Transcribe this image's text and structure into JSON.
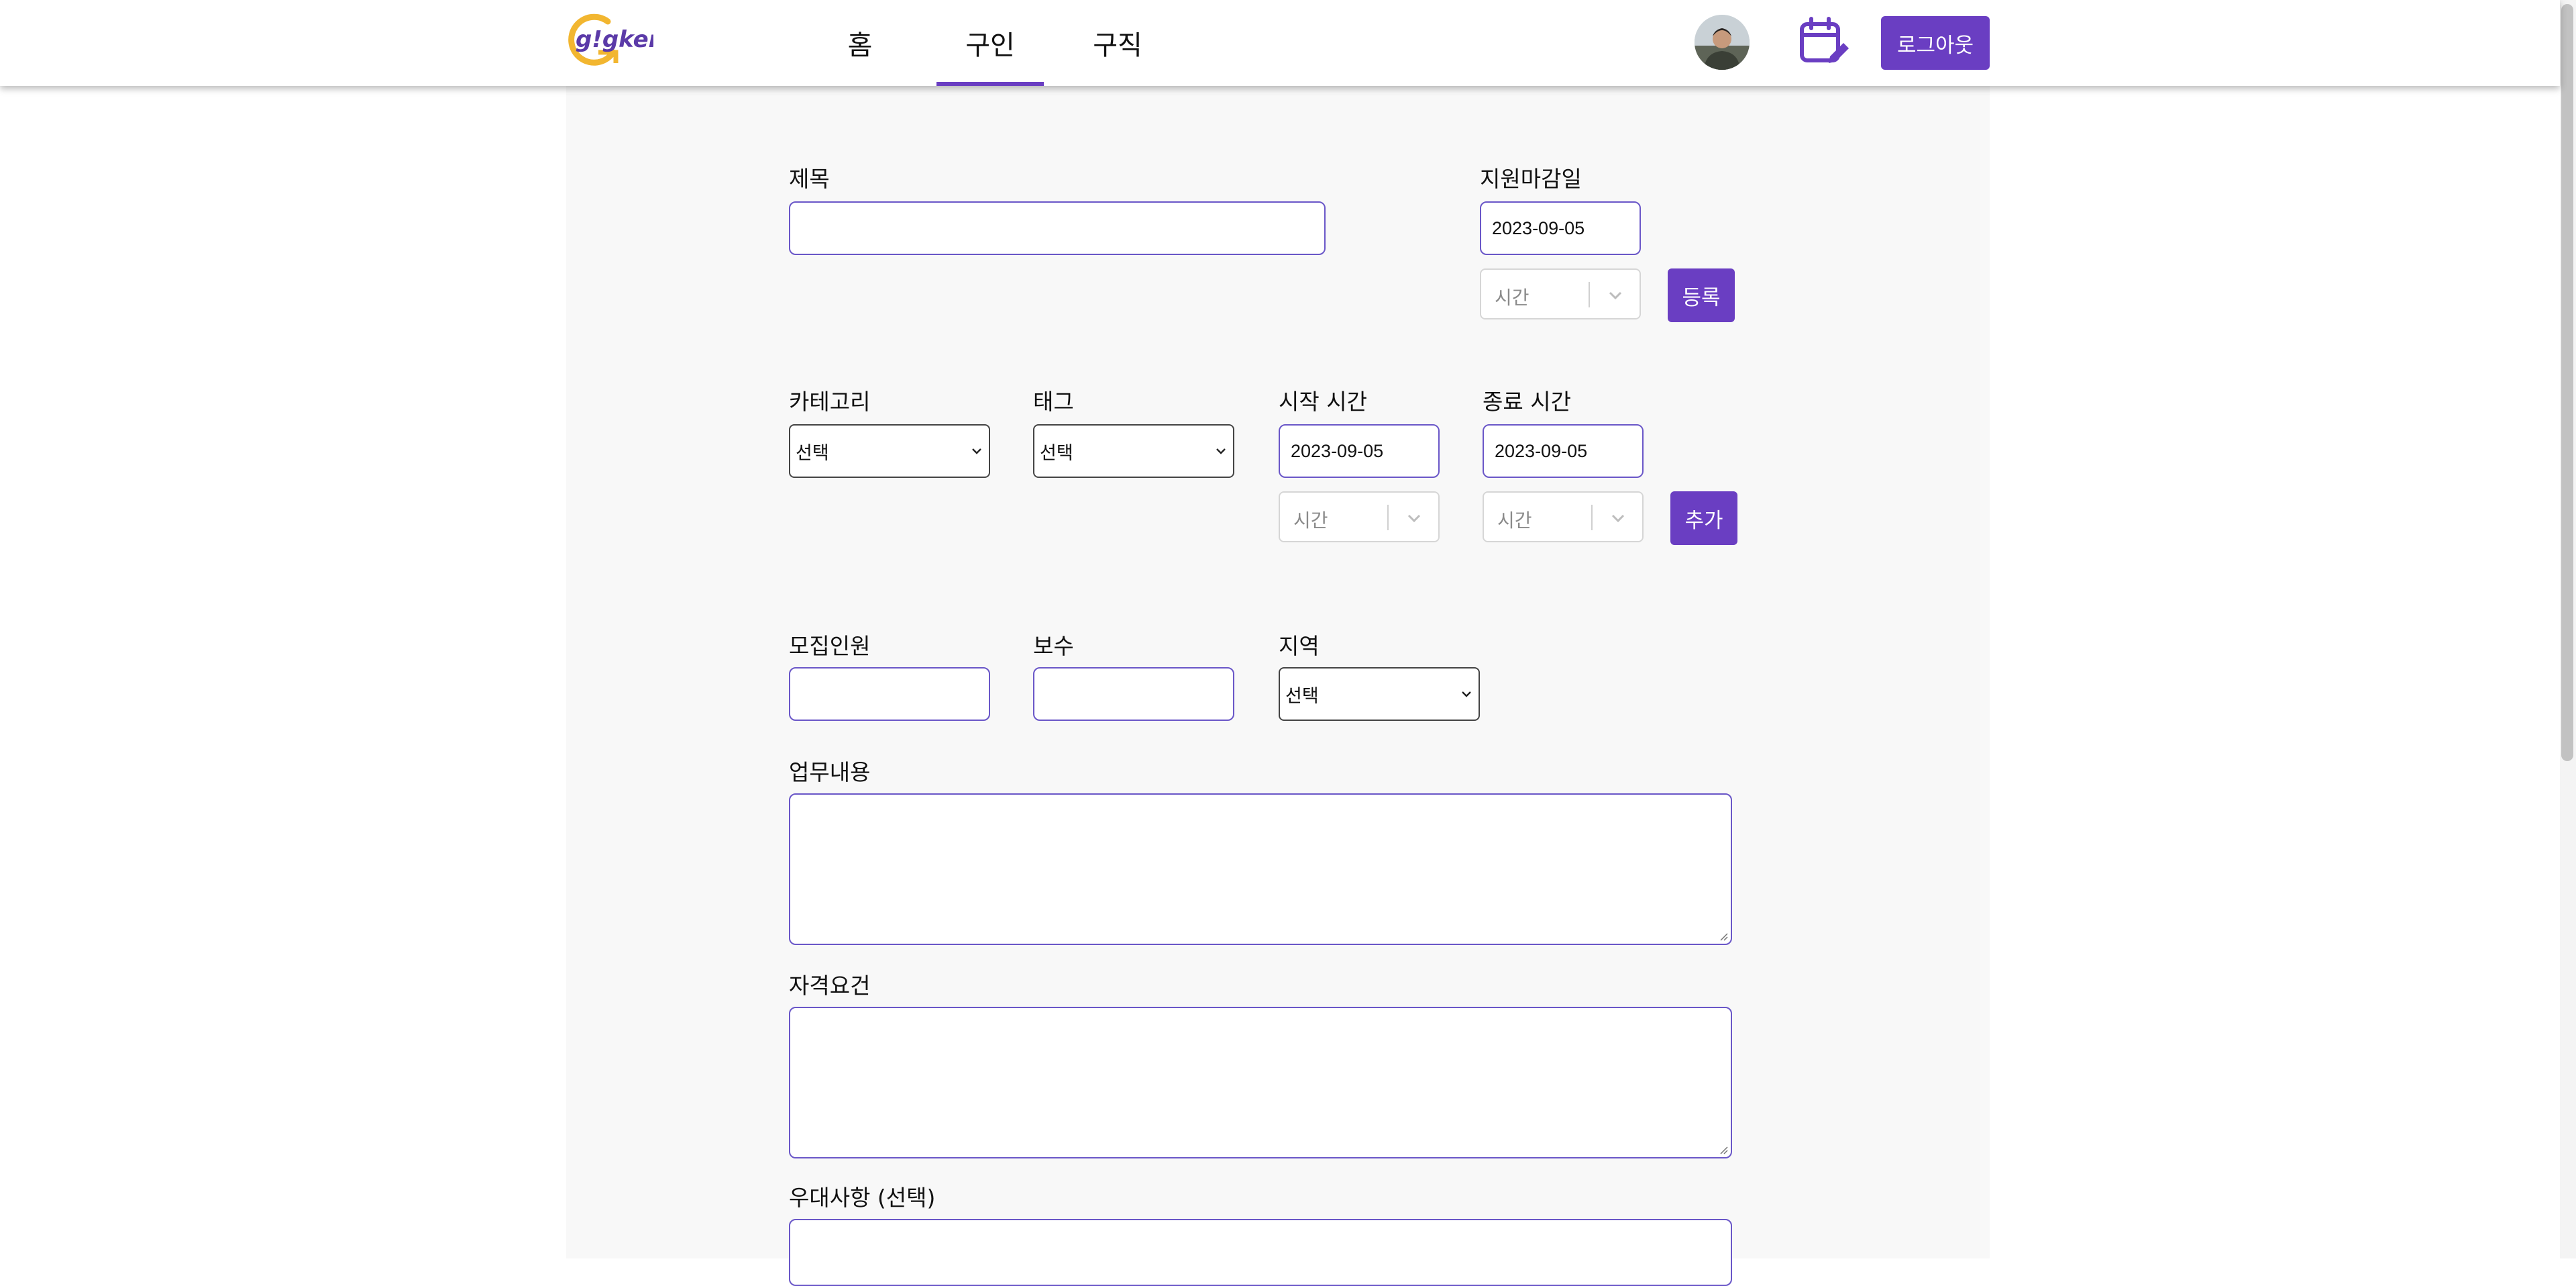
{
  "header": {
    "logo_text": "g!gker",
    "nav": [
      {
        "label": "홈"
      },
      {
        "label": "구인"
      },
      {
        "label": "구직"
      }
    ],
    "active_tab": "구인",
    "logout_label": "로그아웃"
  },
  "form": {
    "title": {
      "label": "제목",
      "value": ""
    },
    "deadline": {
      "label": "지원마감일",
      "date": "2023-09-05",
      "time_placeholder": "시간"
    },
    "register_label": "등록",
    "category": {
      "label": "카테고리",
      "selected": "선택"
    },
    "tag": {
      "label": "태그",
      "selected": "선택"
    },
    "start_time": {
      "label": "시작 시간",
      "date": "2023-09-05",
      "time_placeholder": "시간"
    },
    "end_time": {
      "label": "종료 시간",
      "date": "2023-09-05",
      "time_placeholder": "시간"
    },
    "add_label": "추가",
    "headcount": {
      "label": "모집인원",
      "value": ""
    },
    "pay": {
      "label": "보수",
      "value": ""
    },
    "region": {
      "label": "지역",
      "selected": "선택"
    },
    "job_description": {
      "label": "업무내용",
      "value": ""
    },
    "qualifications": {
      "label": "자격요건",
      "value": ""
    },
    "preferred": {
      "label": "우대사항 (선택)",
      "value": ""
    }
  },
  "colors": {
    "accent": "#6a3ec2",
    "input_border": "#6a57c8",
    "panel_bg": "#f8f8f8"
  },
  "icons": {
    "logo": "gigker-logo",
    "calendar": "calendar-edit-icon",
    "select_chevron": "chevron-down-icon"
  }
}
